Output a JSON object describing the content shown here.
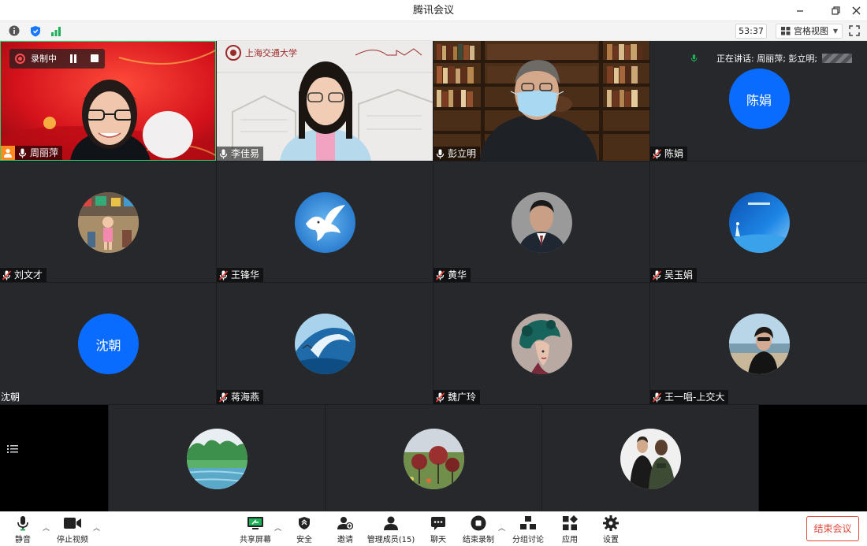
{
  "window": {
    "title": "腾讯会议"
  },
  "topbar": {
    "timer": "53:37",
    "view_label": "宫格视图"
  },
  "recording": {
    "label": "录制中"
  },
  "speaking": {
    "text": "正在讲话: 周丽萍; 彭立明;"
  },
  "participants": [
    {
      "name": "周丽萍",
      "kind": "video-red",
      "mic": "on",
      "host": true
    },
    {
      "name": "李佳易",
      "kind": "video-campus",
      "mic": "on"
    },
    {
      "name": "彭立明",
      "kind": "video-library",
      "mic": "on"
    },
    {
      "name": "陈娟",
      "kind": "text-avatar",
      "avatar_text": "陈娟",
      "mic": "muted"
    },
    {
      "name": "刘文才",
      "kind": "photo-avatar",
      "mic": "muted"
    },
    {
      "name": "王锋华",
      "kind": "photo-avatar",
      "mic": "muted"
    },
    {
      "name": "黄华",
      "kind": "photo-avatar",
      "mic": "muted"
    },
    {
      "name": "吴玉娟",
      "kind": "photo-avatar",
      "mic": "muted"
    },
    {
      "name": "沈朝",
      "kind": "text-avatar",
      "avatar_text": "沈朝",
      "mic": "none"
    },
    {
      "name": "蒋海燕",
      "kind": "photo-avatar",
      "mic": "muted"
    },
    {
      "name": "魏广玲",
      "kind": "photo-avatar",
      "mic": "muted"
    },
    {
      "name": "王一唱-上交大",
      "kind": "photo-avatar",
      "mic": "muted"
    }
  ],
  "toolbar": {
    "mute": "静音",
    "stop_video": "停止视频",
    "share_screen": "共享屏幕",
    "security": "安全",
    "invite": "邀请",
    "manage_members": "管理成员(15)",
    "chat": "聊天",
    "stop_recording": "结束录制",
    "breakout": "分组讨论",
    "apps": "应用",
    "settings": "设置",
    "end_meeting": "结束会议"
  },
  "colors": {
    "accent_blue": "#0a6cff",
    "end_red": "#e24a3b",
    "host_orange": "#ff8a1f"
  }
}
